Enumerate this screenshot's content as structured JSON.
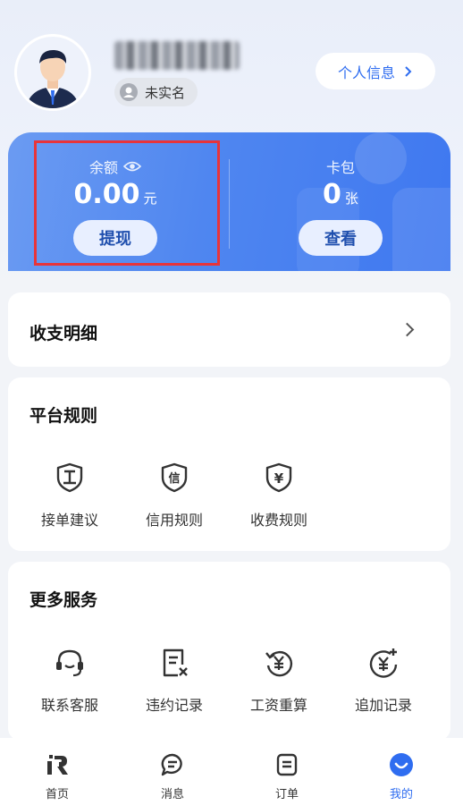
{
  "profile": {
    "realname_status": "未实名",
    "personal_info_label": "个人信息"
  },
  "wallet": {
    "balance_label": "余额",
    "balance_value": "0.00",
    "balance_unit": "元",
    "withdraw_label": "提现",
    "cards_label": "卡包",
    "cards_value": "0",
    "cards_unit": "张",
    "view_label": "查看"
  },
  "statement": {
    "title": "收支明细"
  },
  "platform_rules": {
    "title": "平台规则",
    "items": [
      {
        "label": "接单建议",
        "icon": "shield-gong-icon",
        "glyph": "工"
      },
      {
        "label": "信用规则",
        "icon": "shield-xin-icon",
        "glyph": "信"
      },
      {
        "label": "收费规则",
        "icon": "shield-yen-icon",
        "glyph": "¥"
      }
    ]
  },
  "more_services": {
    "title": "更多服务",
    "items": [
      {
        "label": "联系客服",
        "icon": "headset-icon"
      },
      {
        "label": "违约记录",
        "icon": "document-x-icon"
      },
      {
        "label": "工资重算",
        "icon": "yen-refresh-icon"
      },
      {
        "label": "追加记录",
        "icon": "yen-plus-icon"
      }
    ]
  },
  "nav": {
    "items": [
      {
        "label": "首页",
        "icon": "home-logo-icon"
      },
      {
        "label": "消息",
        "icon": "message-icon"
      },
      {
        "label": "订单",
        "icon": "order-icon"
      },
      {
        "label": "我的",
        "icon": "profile-smile-icon",
        "active": true
      }
    ]
  },
  "colors": {
    "accent": "#2f6df0",
    "highlight": "#e8343a"
  }
}
